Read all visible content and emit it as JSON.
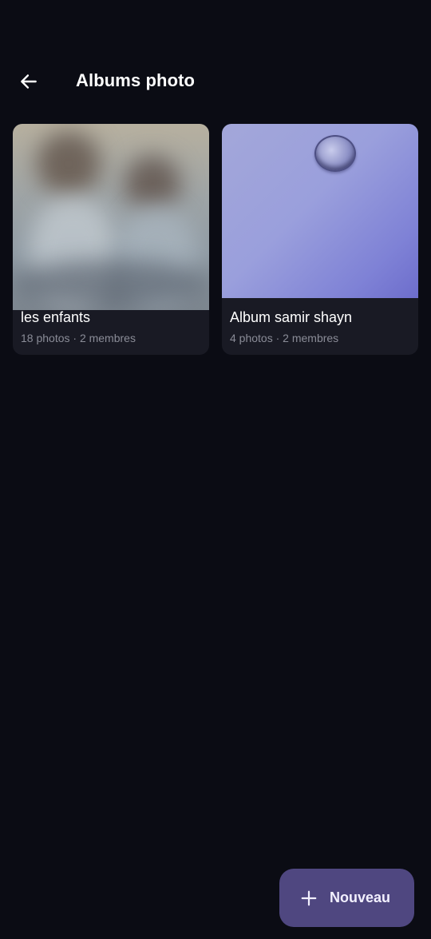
{
  "header": {
    "back_icon": "arrow-left-icon",
    "title": "Albums photo"
  },
  "albums": [
    {
      "name": "les enfants",
      "meta": "18 photos · 2 membres",
      "thumbnail": "blurred-photo-two-children"
    },
    {
      "name": "Album samir shayn",
      "meta": "4 photos · 2 membres",
      "thumbnail": "purple-water-drop-photo"
    }
  ],
  "fab": {
    "icon": "plus-icon",
    "label": "Nouveau"
  },
  "colors": {
    "background": "#0b0c14",
    "card": "#191a24",
    "fab": "#4f4780",
    "meta_text": "#8a8c97"
  }
}
